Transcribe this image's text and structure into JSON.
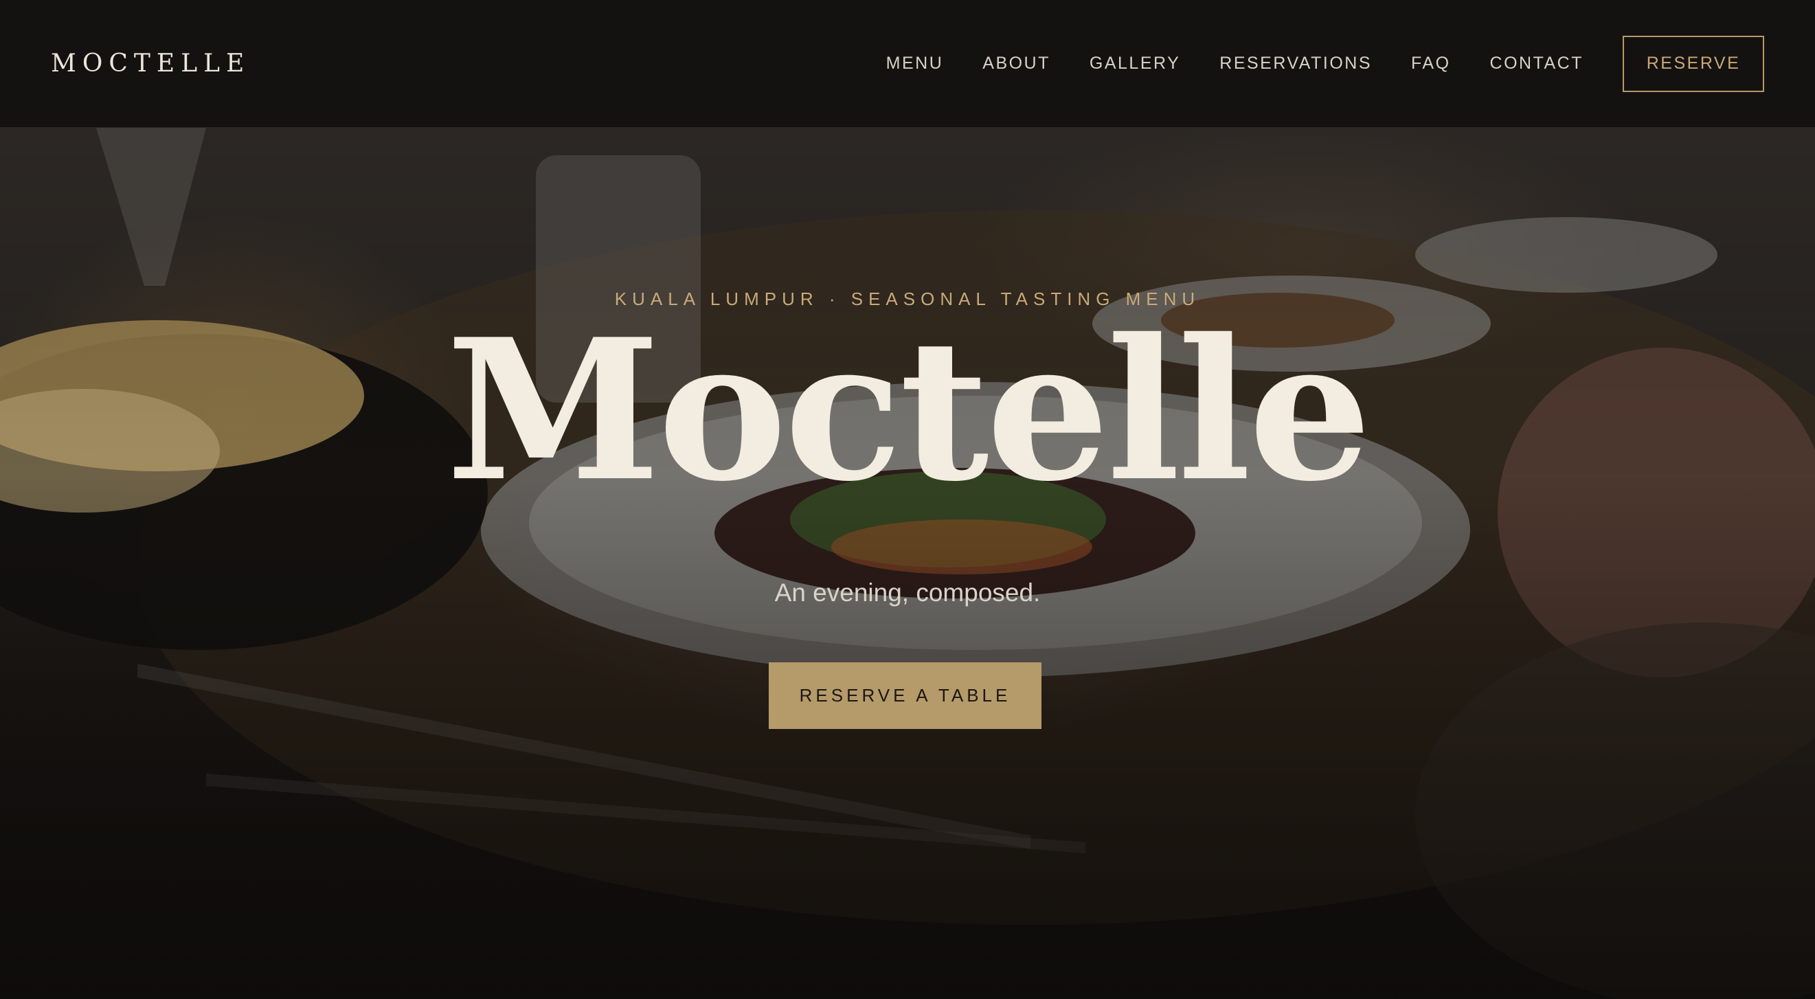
{
  "header": {
    "brand": "MOCTELLE",
    "nav": [
      "MENU",
      "ABOUT",
      "GALLERY",
      "RESERVATIONS",
      "FAQ",
      "CONTACT"
    ],
    "reserve_label": "RESERVE"
  },
  "hero": {
    "eyebrow": "KUALA LUMPUR · SEASONAL TASTING MENU",
    "title": "Moctelle",
    "tagline": "An evening, composed.",
    "cta_label": "RESERVE A TABLE"
  },
  "colors": {
    "header_bg": "#141210",
    "accent_gold": "#b59a6a",
    "title_cream": "#f3ece0"
  }
}
